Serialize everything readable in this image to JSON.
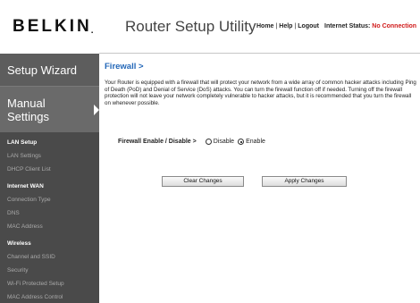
{
  "header": {
    "logo": "BELKIN",
    "logo_mark": ".",
    "title": "Router Setup Utility",
    "links": [
      "Home",
      "Help",
      "Logout"
    ],
    "separator": "|",
    "status_label": "Internet Status:",
    "status_value": "No Connection"
  },
  "sidebar": {
    "setup_wizard": "Setup Wizard",
    "manual_settings": "Manual Settings",
    "sections": [
      {
        "title": "LAN Setup",
        "items": [
          "LAN Settings",
          "DHCP Client List"
        ]
      },
      {
        "title": "Internet WAN",
        "items": [
          "Connection Type",
          "DNS",
          "MAC Address"
        ]
      },
      {
        "title": "Wireless",
        "items": [
          "Channel and SSID",
          "Security",
          "Wi-Fi Protected Setup",
          "MAC Address Control"
        ]
      }
    ]
  },
  "main": {
    "title": "Firewall >",
    "description": "Your Router is equipped with a firewall that will protect your network from a wide array of common hacker attacks including Ping of Death (PoD) and Denial of Service (DoS) attacks. You can turn the firewall function off if needed. Turning off the firewall protection will not leave your network completely vulnerable to hacker attacks, but it is recommended that you turn the firewall on whenever possible.",
    "firewall_label": "Firewall Enable / Disable >",
    "options": [
      {
        "label": "Disable",
        "checked": false
      },
      {
        "label": "Enable",
        "checked": true
      }
    ],
    "clear_button": "Clear Changes",
    "apply_button": "Apply Changes"
  },
  "colors": {
    "title_blue": "#2367b8",
    "status_red": "#d01a1a",
    "sidebar_dark": "#4a4a4a"
  }
}
